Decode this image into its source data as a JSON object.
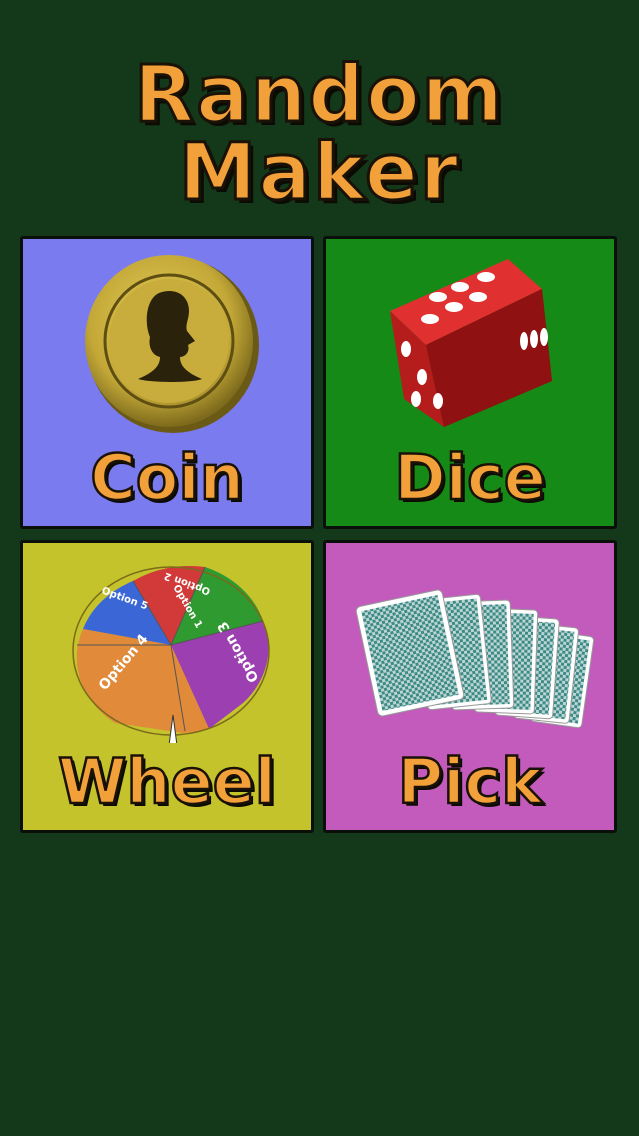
{
  "app": {
    "title": "Random Maker"
  },
  "tiles": [
    {
      "label": "Coin",
      "color": "#7b7bf0",
      "icon": "coin-icon"
    },
    {
      "label": "Dice",
      "color": "#168a16",
      "icon": "dice-icon"
    },
    {
      "label": "Wheel",
      "color": "#c4c32c",
      "icon": "wheel-icon"
    },
    {
      "label": "Pick",
      "color": "#c25bbc",
      "icon": "cards-icon"
    }
  ],
  "wheel": {
    "segments": [
      "Option 1",
      "Option 2",
      "Option 3",
      "Option 4",
      "Option 5",
      "Option 6"
    ]
  },
  "colors": {
    "background": "#13381a",
    "title": "#f2a03a"
  }
}
